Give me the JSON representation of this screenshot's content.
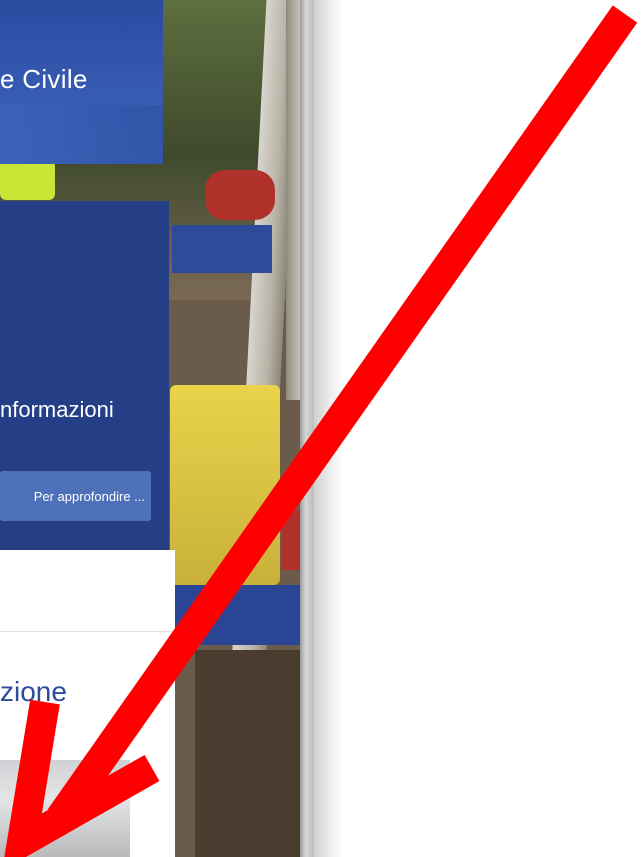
{
  "header": {
    "title": "e Civile"
  },
  "info_panel": {
    "text": "nformazioni",
    "button_label": "Per approfondire ..."
  },
  "section": {
    "heading": "zione"
  },
  "colors": {
    "brand_blue": "#243f85",
    "button_blue": "#4f71ba",
    "heading_blue": "#2d4b9a",
    "arrow_red": "#ff0000"
  },
  "icons": {
    "annotation": "arrow-down-left-icon"
  }
}
